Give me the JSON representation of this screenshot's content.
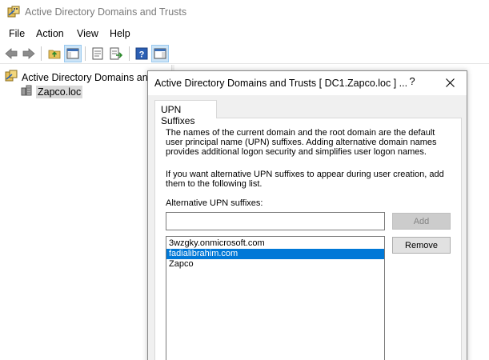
{
  "window": {
    "title": "Active Directory Domains and Trusts"
  },
  "menu": [
    "File",
    "Action",
    "View",
    "Help"
  ],
  "toolbar": {
    "buttons": [
      "back-icon",
      "forward-icon",
      "up-folder-icon",
      "show-hide-tree-icon",
      "properties-icon",
      "export-list-icon",
      "help-icon",
      "show-action-pane-icon"
    ]
  },
  "tree": {
    "root_label": "Active Directory Domains and Trusts",
    "child_label": "Zapco.loc"
  },
  "dialog": {
    "title": "Active Directory Domains and Trusts [ DC1.Zapco.loc ] ...",
    "help_label": "?",
    "tab_label": "UPN Suffixes",
    "paragraph1": "The names of the current domain and the root domain are the default user principal name (UPN) suffixes. Adding alternative domain names provides additional logon security and simplifies user logon names.",
    "paragraph2": "If you want alternative UPN suffixes to appear during user creation, add them to the following list.",
    "field_label": "Alternative UPN suffixes:",
    "input_value": "",
    "add_label": "Add",
    "remove_label": "Remove",
    "suffixes": [
      "3wzgky.onmicrosoft.com",
      "fadialibrahim.com",
      "Zapco"
    ],
    "selected_index": 1
  },
  "colors": {
    "selection": "#0078d7",
    "disabled_button": "#cccccc"
  }
}
